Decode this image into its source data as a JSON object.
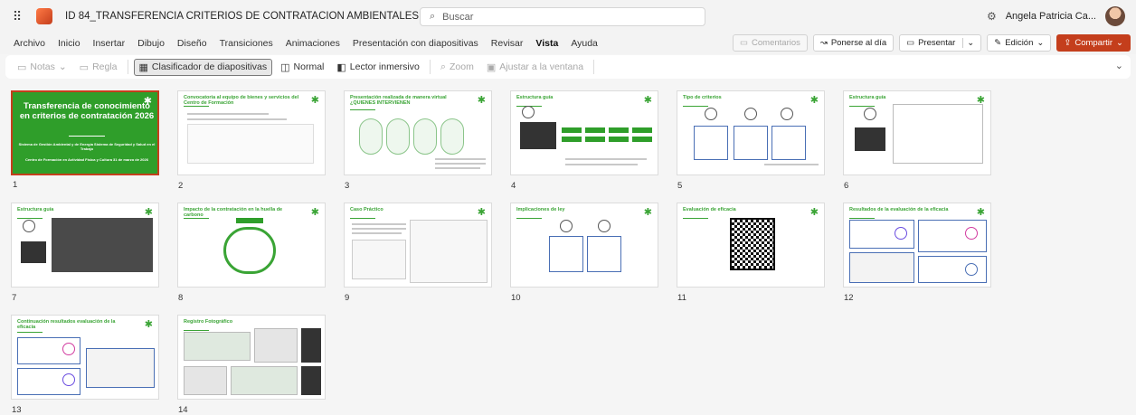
{
  "titlebar": {
    "doc_title": "ID 84_TRANSFERENCIA CRITERIOS DE CONTRATACION AMBIENTALES Y SST_2...",
    "search_placeholder": "Buscar",
    "user_name": "Angela Patricia Ca..."
  },
  "menu": {
    "items": [
      "Archivo",
      "Inicio",
      "Insertar",
      "Dibujo",
      "Diseño",
      "Transiciones",
      "Animaciones",
      "Presentación con diapositivas",
      "Revisar",
      "Vista",
      "Ayuda"
    ],
    "active": "Vista",
    "comments": "Comentarios",
    "catch_up": "Ponerse al día",
    "present": "Presentar",
    "editing": "Edición",
    "share": "Compartir"
  },
  "ribbon": {
    "notes": "Notas",
    "ruler": "Regla",
    "slide_sorter": "Clasificador de diapositivas",
    "normal": "Normal",
    "immersive_reader": "Lector inmersivo",
    "zoom": "Zoom",
    "fit_window": "Ajustar a la ventana"
  },
  "slides": [
    {
      "num": "1",
      "title": "Transferencia de conocimiento en criterios de contratación 2026",
      "subtitle": "Sistema de Gestión Ambiental y de Energía Sistema de Seguridad y Salud en el Trabajo",
      "date": "Centro de Formación en Actividad Física y Cultura 31 de marzo de 2026"
    },
    {
      "num": "2",
      "title": "Convocatoria al equipo de bienes y servicios del Centro de Formación"
    },
    {
      "num": "3",
      "title": "Presentación realizada de manera virtual ¿QUIENES INTERVIENEN"
    },
    {
      "num": "4",
      "title": "Estructura guía"
    },
    {
      "num": "5",
      "title": "Tipo de criterios"
    },
    {
      "num": "6",
      "title": "Estructura guía"
    },
    {
      "num": "7",
      "title": "Estructura guía"
    },
    {
      "num": "8",
      "title": "Impacto de la contratación en la huella de carbono"
    },
    {
      "num": "9",
      "title": "Caso Práctico"
    },
    {
      "num": "10",
      "title": "Implicaciones de ley"
    },
    {
      "num": "11",
      "title": "Evaluación de eficacia"
    },
    {
      "num": "12",
      "title": "Resultados de la evaluación de la eficacia"
    },
    {
      "num": "13",
      "title": "Continuación resultados evaluación de la eficacia"
    },
    {
      "num": "14",
      "title": "Registro Fotográfico"
    }
  ]
}
